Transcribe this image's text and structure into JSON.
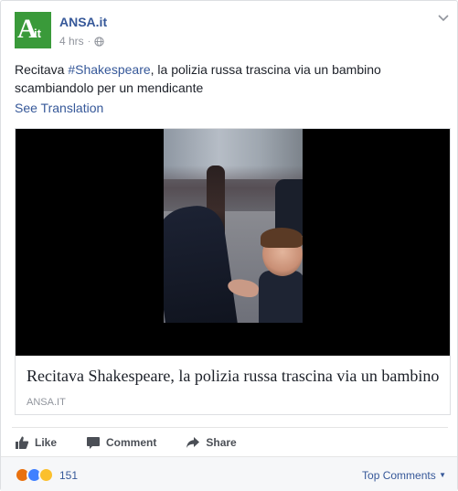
{
  "post": {
    "page_name": "ANSA.it",
    "avatar_letter": "A",
    "avatar_suffix": "it",
    "time": "4 hrs",
    "separator": "·",
    "text_before": "Recitava ",
    "hashtag": "#Shakespeare",
    "text_after": ", la polizia russa trascina via un bambino scambiandolo per un mendicante",
    "see_translation": "See Translation"
  },
  "link": {
    "title": "Recitava Shakespeare, la polizia russa trascina via un bambino",
    "domain": "ANSA.IT"
  },
  "actions": {
    "like": "Like",
    "comment": "Comment",
    "share": "Share"
  },
  "footer": {
    "reaction_count": "151",
    "top_comments": "Top Comments"
  },
  "colors": {
    "link_blue": "#365899",
    "avatar_green": "#3a9a3a",
    "angry": "#e9710f",
    "like": "#4080ff",
    "haha": "#fbc02d"
  },
  "icons": [
    "chevron-down-icon",
    "globe-icon",
    "like-icon",
    "comment-icon",
    "share-icon",
    "angry-reaction-icon",
    "like-reaction-icon",
    "haha-reaction-icon"
  ]
}
